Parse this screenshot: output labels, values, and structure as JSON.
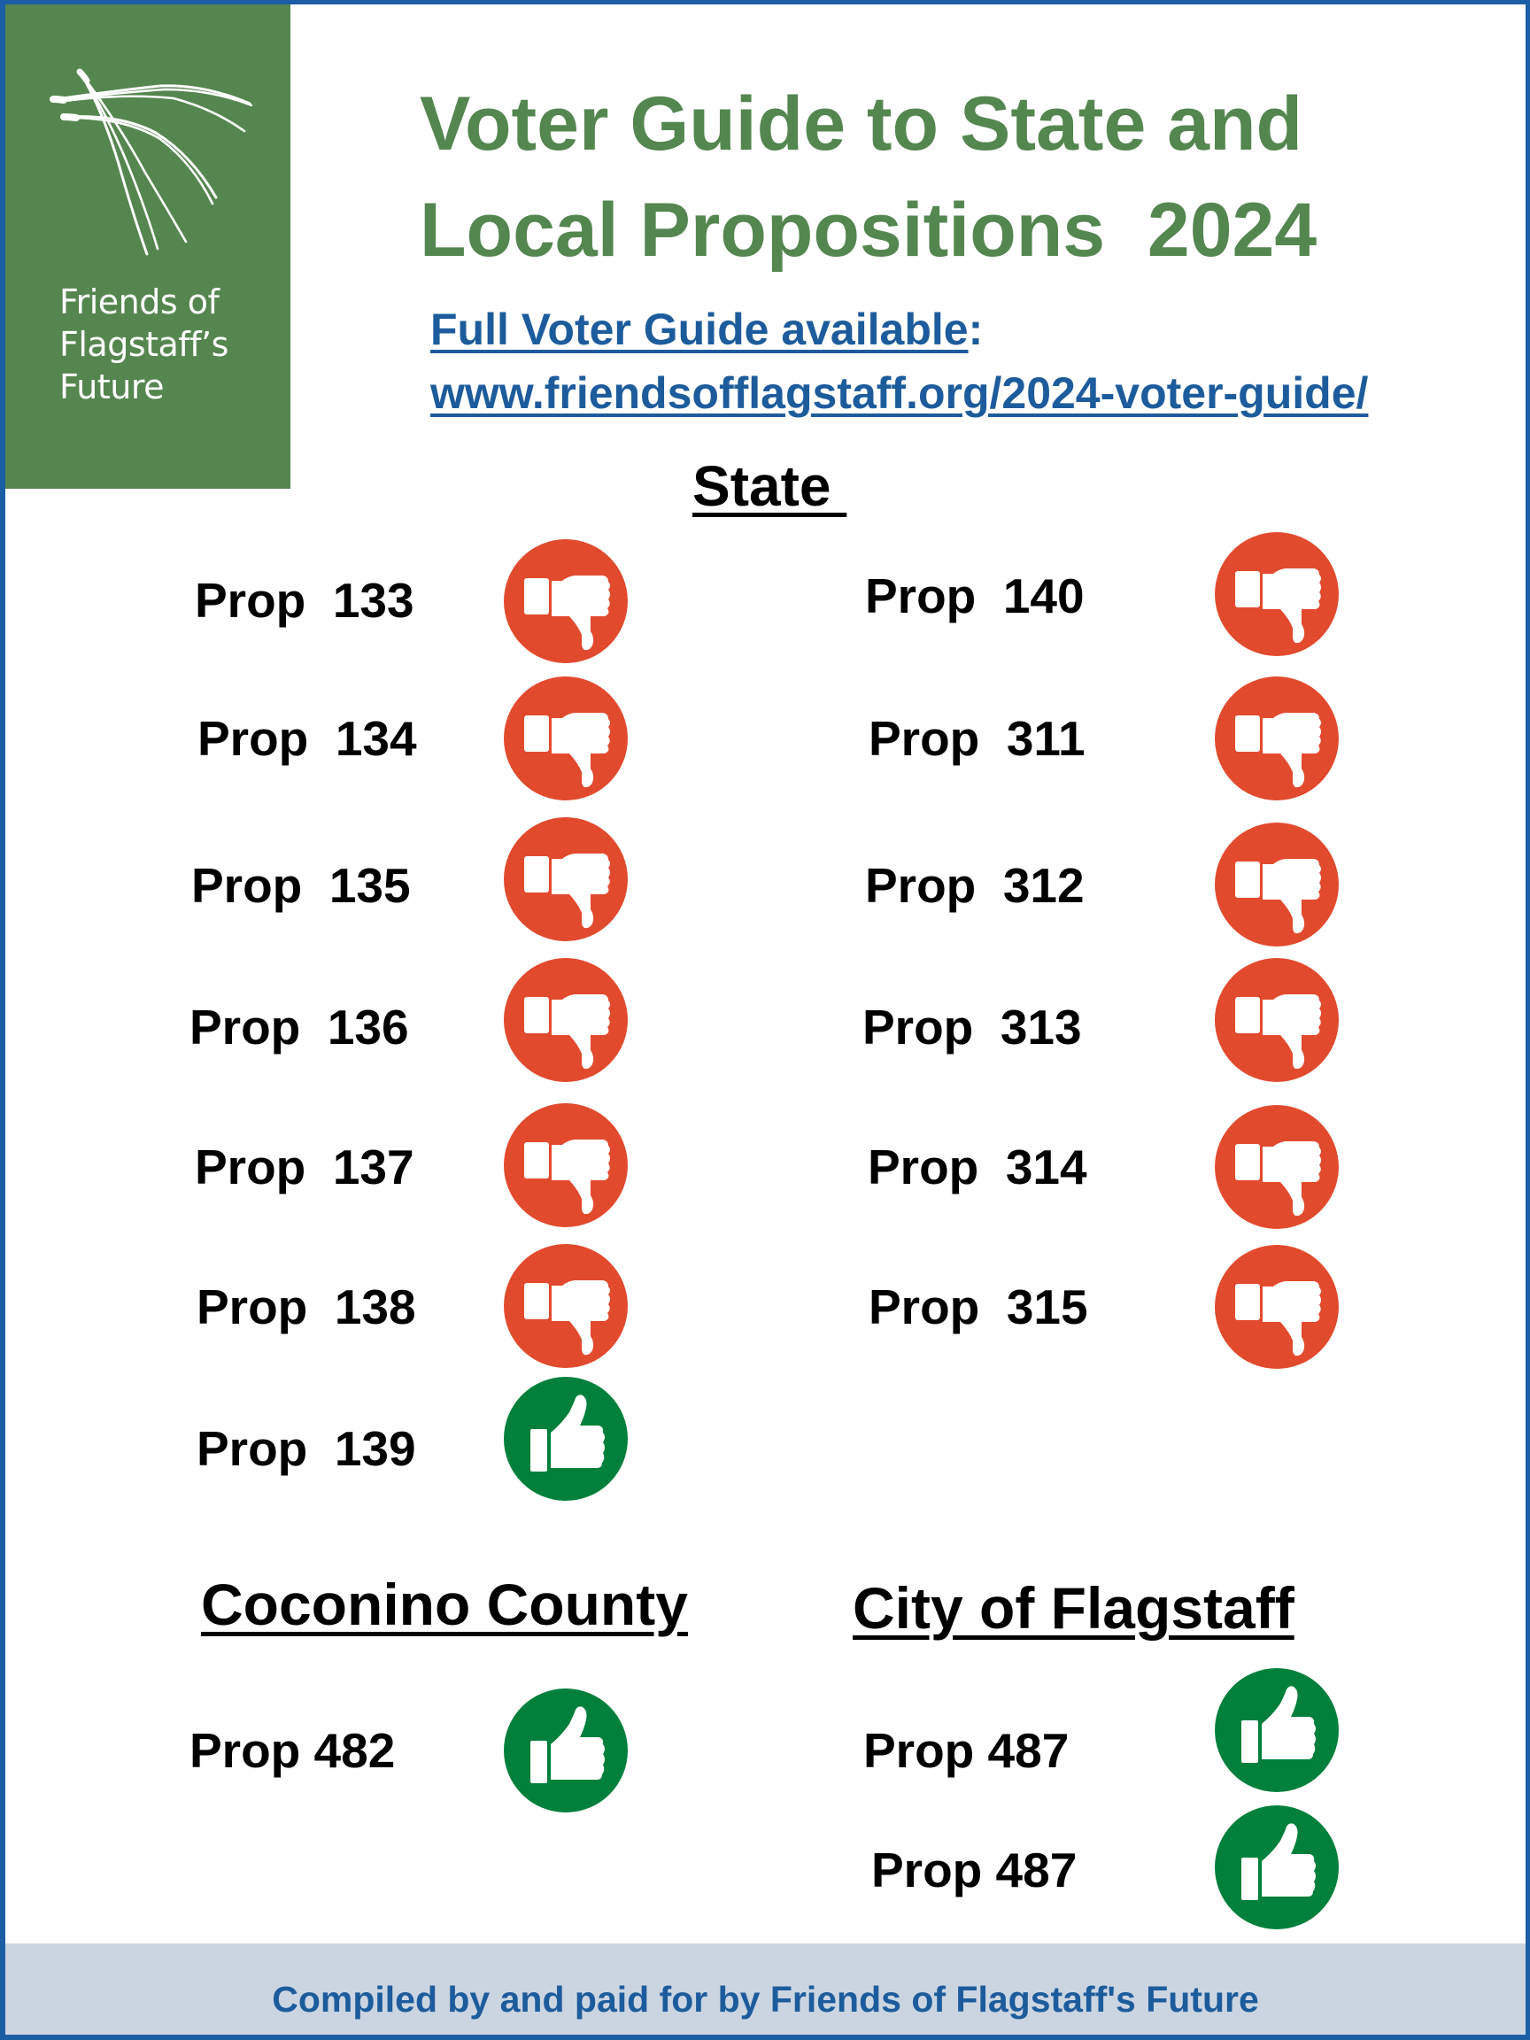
{
  "logo": {
    "icon": "pine-needles-icon",
    "lines": [
      "Friends of",
      "Flagstaff’s",
      "Future"
    ],
    "background_color": "#55864f"
  },
  "title": {
    "line1": "Voter Guide to State and",
    "line2": "Local Propositions  2024",
    "color": "#548650"
  },
  "guide_link": {
    "label": "Full Voter Guide available",
    "colon": ":",
    "url_text": "www.friendsofflagstaff.org/2024-voter-guide/",
    "color": "#1d5c9c"
  },
  "sections": {
    "state": {
      "heading": "State ",
      "left_column": [
        {
          "label": "Prop  133",
          "recommendation": "no",
          "icon": "thumbs-down-icon"
        },
        {
          "label": "Prop  134",
          "recommendation": "no",
          "icon": "thumbs-down-icon"
        },
        {
          "label": "Prop  135",
          "recommendation": "no",
          "icon": "thumbs-down-icon"
        },
        {
          "label": "Prop  136",
          "recommendation": "no",
          "icon": "thumbs-down-icon"
        },
        {
          "label": "Prop  137",
          "recommendation": "no",
          "icon": "thumbs-down-icon"
        },
        {
          "label": "Prop  138",
          "recommendation": "no",
          "icon": "thumbs-down-icon"
        },
        {
          "label": "Prop  139",
          "recommendation": "yes",
          "icon": "thumbs-up-icon"
        }
      ],
      "right_column": [
        {
          "label": "Prop  140",
          "recommendation": "no",
          "icon": "thumbs-down-icon"
        },
        {
          "label": "Prop  311",
          "recommendation": "no",
          "icon": "thumbs-down-icon"
        },
        {
          "label": "Prop  312",
          "recommendation": "no",
          "icon": "thumbs-down-icon"
        },
        {
          "label": "Prop  313",
          "recommendation": "no",
          "icon": "thumbs-down-icon"
        },
        {
          "label": "Prop  314",
          "recommendation": "no",
          "icon": "thumbs-down-icon"
        },
        {
          "label": "Prop  315",
          "recommendation": "no",
          "icon": "thumbs-down-icon"
        }
      ]
    },
    "county": {
      "heading": "Coconino County",
      "items": [
        {
          "label": "Prop 482",
          "recommendation": "yes",
          "icon": "thumbs-up-icon"
        }
      ]
    },
    "city": {
      "heading": "City of Flagstaff",
      "items": [
        {
          "label": "Prop 487",
          "recommendation": "yes",
          "icon": "thumbs-up-icon"
        },
        {
          "label": "Prop 487",
          "recommendation": "yes",
          "icon": "thumbs-up-icon"
        }
      ]
    }
  },
  "colors": {
    "no": "#e24a2d",
    "yes": "#00803a",
    "border": "#1c5ea5",
    "footer_background": "#cbd5e1"
  },
  "footer": {
    "text": "Compiled by and paid for by Friends of Flagstaff's Future"
  }
}
